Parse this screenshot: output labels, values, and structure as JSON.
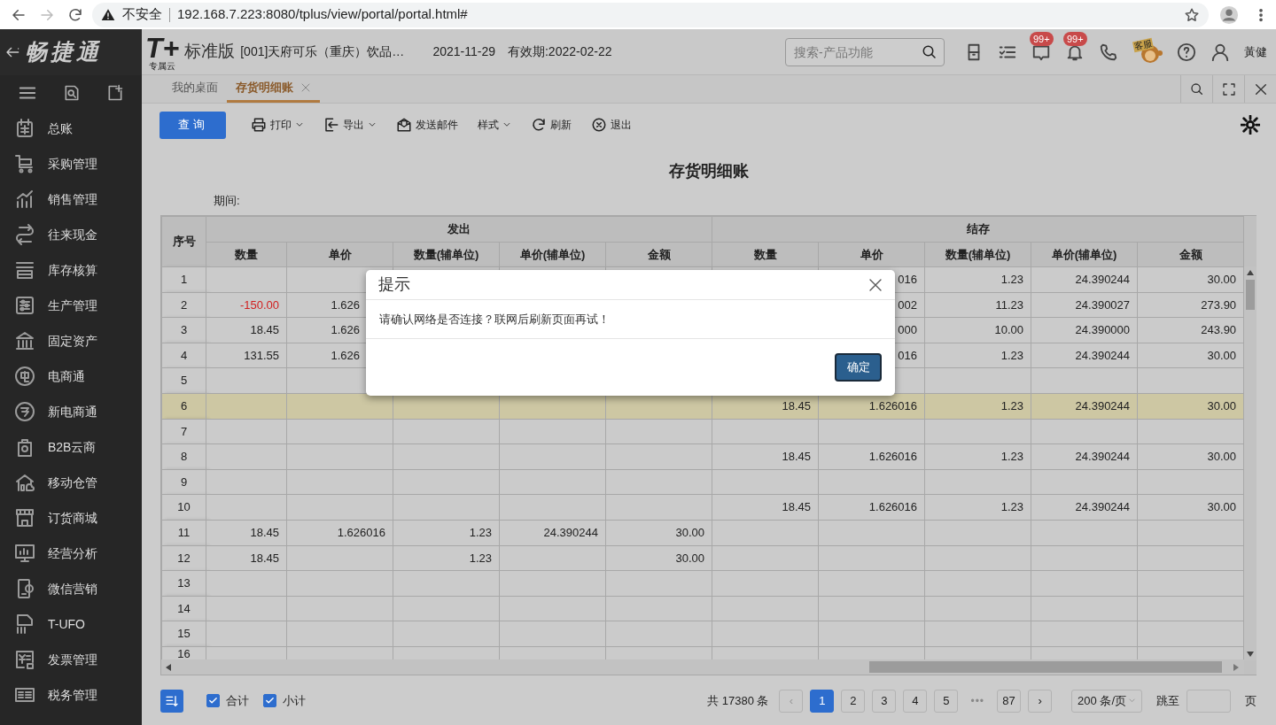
{
  "browser": {
    "warning": "不安全",
    "url": "192.168.7.223:8080/tplus/view/portal/portal.html#"
  },
  "sidebar": {
    "logo": "畅捷通",
    "items": [
      {
        "label": "总账"
      },
      {
        "label": "采购管理"
      },
      {
        "label": "销售管理"
      },
      {
        "label": "往来现金"
      },
      {
        "label": "库存核算"
      },
      {
        "label": "生产管理"
      },
      {
        "label": "固定资产"
      },
      {
        "label": "电商通"
      },
      {
        "label": "新电商通"
      },
      {
        "label": "B2B云商"
      },
      {
        "label": "移动仓管"
      },
      {
        "label": "订货商城"
      },
      {
        "label": "经营分析"
      },
      {
        "label": "微信营销"
      },
      {
        "label": "T-UFO"
      },
      {
        "label": "发票管理"
      },
      {
        "label": "税务管理"
      }
    ]
  },
  "header": {
    "product_logo": "T+",
    "logo_sub": "专属云",
    "edition": "标准版",
    "company": "[001]天府可乐（重庆）饮品…",
    "date": "2021-11-29",
    "validity": "有效期:2022-02-22",
    "search": {
      "placeholder": "搜索-产品功能"
    },
    "message_badge": "99+",
    "alert_badge": "99+",
    "mascot_sign": "客服",
    "user": "黃健"
  },
  "tabs": [
    {
      "label": "我的桌面",
      "selected": false,
      "closable": false
    },
    {
      "label": "存货明细账",
      "selected": true,
      "closable": true
    }
  ],
  "toolbar": [
    {
      "label": "查询",
      "kind": "primary"
    },
    {
      "label": "打印",
      "kind": "dropdown"
    },
    {
      "label": "导出",
      "kind": "dropdown"
    },
    {
      "label": "发送邮件",
      "kind": "plain"
    },
    {
      "label": "样式",
      "kind": "dropdown"
    },
    {
      "label": "刷新",
      "kind": "plain"
    },
    {
      "label": "退出",
      "kind": "plain"
    }
  ],
  "report": {
    "title": "存货明细账",
    "period_label": "期间:"
  },
  "table": {
    "seq_header": "序号",
    "groups": [
      {
        "label": "发出",
        "columns": [
          "数量",
          "单价",
          "数量(辅单位)",
          "单价(辅单位)",
          "金额"
        ]
      },
      {
        "label": "结存",
        "columns": [
          "数量",
          "单价",
          "数量(辅单位)",
          "单价(辅单位)",
          "金额"
        ]
      }
    ],
    "rows": [
      {
        "seq": "1",
        "selected": false,
        "cells": [
          null,
          null,
          null,
          null,
          null,
          null,
          "016",
          "1.23",
          "24.390244",
          "30.00"
        ]
      },
      {
        "seq": "2",
        "selected": false,
        "cells": [
          {
            "text": "-150.00",
            "kind": "negative"
          },
          {
            "text": "1.626",
            "kind": "cut"
          },
          null,
          null,
          null,
          null,
          "002",
          "11.23",
          "24.390027",
          "273.90"
        ]
      },
      {
        "seq": "3",
        "selected": false,
        "cells": [
          "18.45",
          {
            "text": "1.626",
            "kind": "cut"
          },
          null,
          null,
          null,
          null,
          "000",
          "10.00",
          "24.390000",
          "243.90"
        ]
      },
      {
        "seq": "4",
        "selected": false,
        "cells": [
          "131.55",
          {
            "text": "1.626",
            "kind": "cut"
          },
          null,
          null,
          null,
          null,
          "016",
          "1.23",
          "24.390244",
          "30.00"
        ]
      },
      {
        "seq": "5",
        "selected": false,
        "cells": [
          null,
          null,
          null,
          null,
          null,
          null,
          null,
          null,
          null,
          null
        ]
      },
      {
        "seq": "6",
        "selected": true,
        "cells": [
          null,
          null,
          null,
          null,
          null,
          "18.45",
          "1.626016",
          "1.23",
          "24.390244",
          "30.00"
        ]
      },
      {
        "seq": "7",
        "selected": false,
        "cells": [
          null,
          null,
          null,
          null,
          null,
          null,
          null,
          null,
          null,
          null
        ]
      },
      {
        "seq": "8",
        "selected": false,
        "cells": [
          null,
          null,
          null,
          null,
          null,
          "18.45",
          "1.626016",
          "1.23",
          "24.390244",
          "30.00"
        ]
      },
      {
        "seq": "9",
        "selected": false,
        "cells": [
          null,
          null,
          null,
          null,
          null,
          null,
          null,
          null,
          null,
          null
        ]
      },
      {
        "seq": "10",
        "selected": false,
        "cells": [
          null,
          null,
          null,
          null,
          null,
          "18.45",
          "1.626016",
          "1.23",
          "24.390244",
          "30.00"
        ]
      },
      {
        "seq": "11",
        "selected": false,
        "cells": [
          "18.45",
          "1.626016",
          "1.23",
          "24.390244",
          "30.00",
          null,
          null,
          null,
          null,
          null
        ]
      },
      {
        "seq": "12",
        "selected": false,
        "cells": [
          "18.45",
          null,
          "1.23",
          null,
          "30.00",
          null,
          null,
          null,
          null,
          null
        ]
      },
      {
        "seq": "13",
        "selected": false,
        "cells": [
          null,
          null,
          null,
          null,
          null,
          null,
          null,
          null,
          null,
          null
        ]
      },
      {
        "seq": "14",
        "selected": false,
        "cells": [
          null,
          null,
          null,
          null,
          null,
          null,
          null,
          null,
          null,
          null
        ]
      },
      {
        "seq": "15",
        "selected": false,
        "cells": [
          null,
          null,
          null,
          null,
          null,
          null,
          null,
          null,
          null,
          null
        ]
      },
      {
        "seq": "16",
        "selected": false,
        "cells": [
          null,
          null,
          null,
          null,
          null,
          null,
          null,
          null,
          null,
          null
        ]
      }
    ]
  },
  "modal": {
    "title": "提示",
    "message": "请确认网络是否连接？联网后刷新页面再试！",
    "button": "确定"
  },
  "footer": {
    "checkboxes": [
      {
        "label": "合计",
        "checked": true
      },
      {
        "label": "小计",
        "checked": true
      }
    ],
    "total": "共 17380 条",
    "prev": {
      "label": "‹",
      "disabled": true
    },
    "pages": [
      {
        "label": "1",
        "selected": true
      },
      {
        "label": "2",
        "selected": false
      },
      {
        "label": "3",
        "selected": false
      },
      {
        "label": "4",
        "selected": false
      },
      {
        "label": "5",
        "selected": false
      }
    ],
    "ellipsis": "•••",
    "last_page": {
      "label": "87",
      "selected": false
    },
    "next": {
      "label": "›",
      "disabled": false
    },
    "page_size": "200 条/页",
    "jump_label": "跳至",
    "page_unit": "页"
  }
}
